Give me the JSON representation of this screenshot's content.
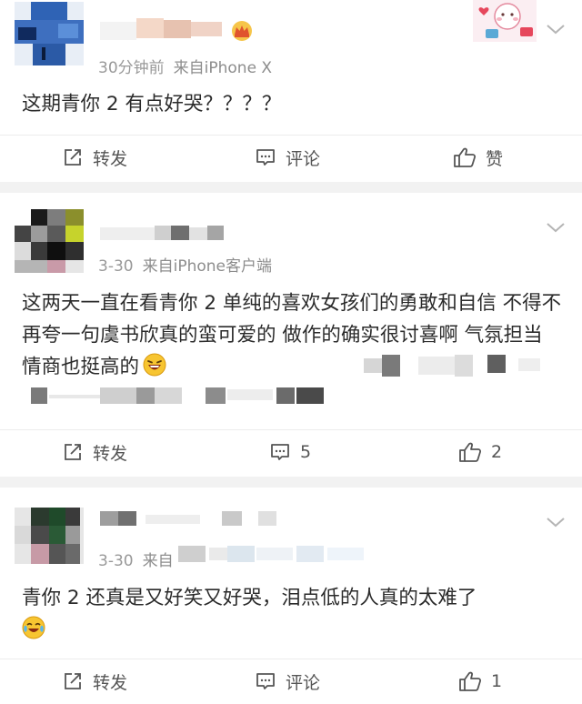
{
  "posts": [
    {
      "time": "30分钟前",
      "source": "来自iPhone X",
      "content": "这期青你 2 有点好哭？？？？",
      "actions": {
        "repost": "转发",
        "comment": "评论",
        "like": "赞"
      }
    },
    {
      "time": "3-30",
      "source": "来自iPhone客户端",
      "content": "这两天一直在看青你 2 单纯的喜欢女孩们的勇敢和自信 不得不再夸一句虞书欣真的蛮可爱的 做作的确实很讨喜啊 气氛担当情商也挺高的",
      "actions": {
        "repost": "转发",
        "comment": "5",
        "like": "2"
      }
    },
    {
      "time": "3-30",
      "source": "来自",
      "content": "青你 2 还真是又好笑又好哭，泪点低的人真的太难了",
      "actions": {
        "repost": "转发",
        "comment": "评论",
        "like": "1"
      }
    }
  ],
  "icons": {
    "repost": "share-icon",
    "comment": "comment-icon",
    "like": "thumb-up-icon",
    "more": "chevron-down-icon",
    "vip": "crown-icon"
  },
  "colors": {
    "separator": "#f2f2f2",
    "meta_text": "#999999",
    "body_text": "#2b2b2b",
    "action_text": "#555555"
  }
}
